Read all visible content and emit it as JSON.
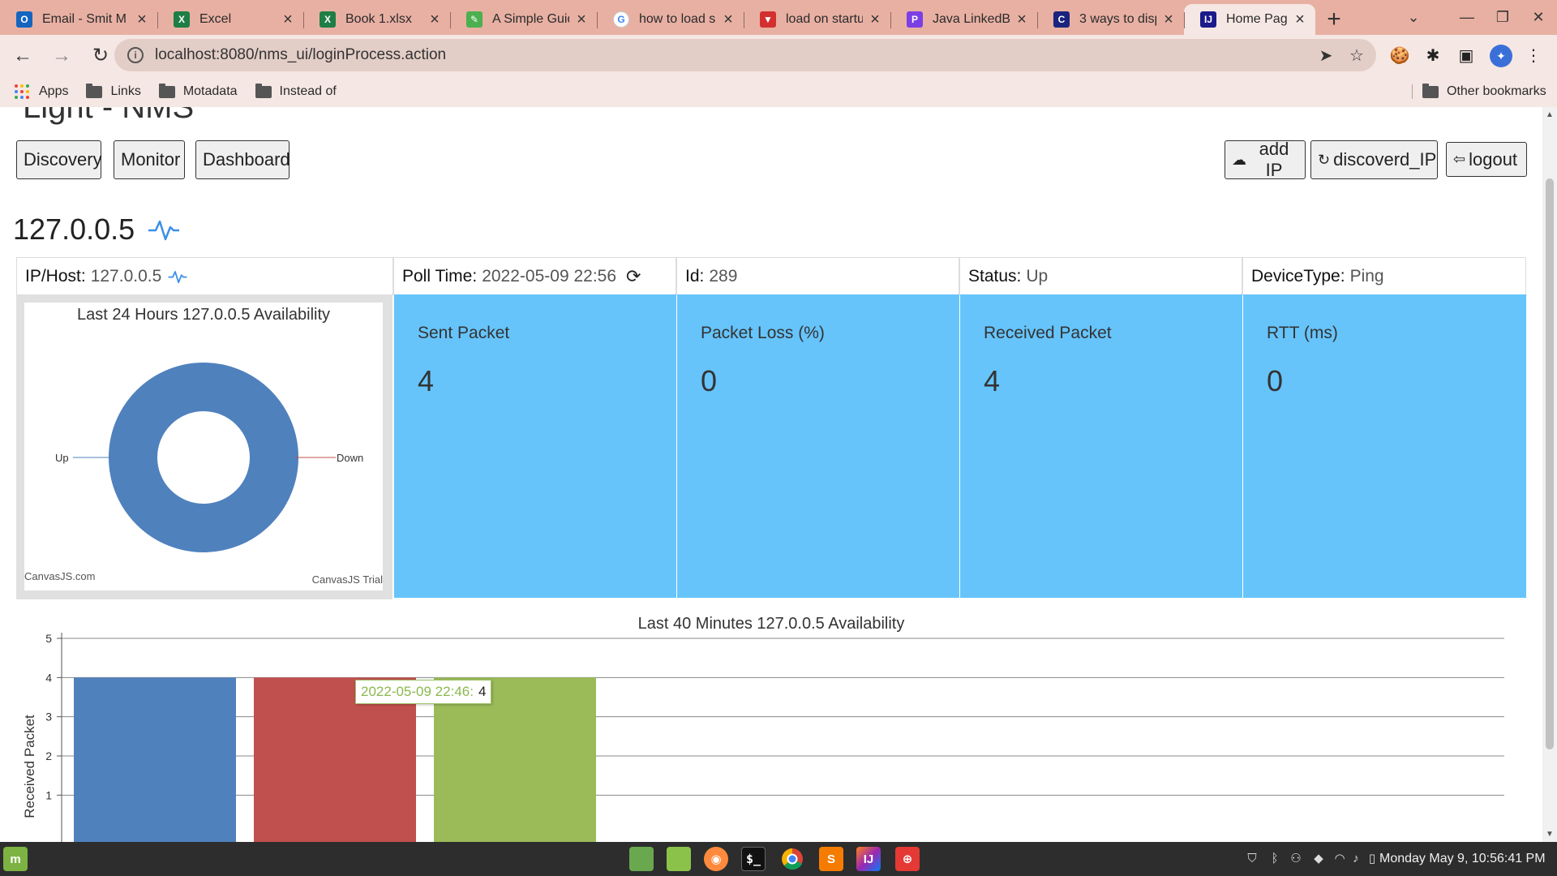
{
  "browser": {
    "tabs": [
      {
        "title": "Email - Smit M",
        "icon": "outlook-icon",
        "color": "#1565c0",
        "glyph": "O"
      },
      {
        "title": "Excel",
        "icon": "excel-icon",
        "color": "#1e7e45",
        "glyph": "X"
      },
      {
        "title": "Book 1.xlsx",
        "icon": "excel-icon",
        "color": "#1e7e45",
        "glyph": "X"
      },
      {
        "title": "A Simple Guid",
        "icon": "leaf-icon",
        "color": "#4caf50",
        "glyph": "✎"
      },
      {
        "title": "how to load s",
        "icon": "google-icon",
        "color": "#ffffff",
        "glyph": "G"
      },
      {
        "title": "load on startu",
        "icon": "vivaldi-icon",
        "color": "#d32f2f",
        "glyph": "▼"
      },
      {
        "title": "Java LinkedBl",
        "icon": "p-icon",
        "color": "#7b3fe4",
        "glyph": "P"
      },
      {
        "title": "3 ways to disp",
        "icon": "c-icon",
        "color": "#1a237e",
        "glyph": "C"
      },
      {
        "title": "Home Page",
        "icon": "intellij-icon",
        "color": "#1a1a8a",
        "glyph": "IJ"
      }
    ],
    "new_tab": "+",
    "url": "localhost:8080/nms_ui/loginProcess.action",
    "bookmarks": [
      "Apps",
      "Links",
      "Motadata",
      "Instead of"
    ],
    "other_bookmarks": "Other bookmarks"
  },
  "header": {
    "brand": "Light - NMS",
    "nav": [
      "Discovery",
      "Monitor",
      "Dashboard"
    ],
    "actions": {
      "add_ip": "add IP",
      "discovered": "discoverd_IP",
      "logout": "logout"
    }
  },
  "host": {
    "title": "127.0.0.5",
    "info": {
      "ip_label": "IP/Host:",
      "ip_value": "127.0.0.5",
      "poll_label": "Poll Time:",
      "poll_value": "2022-05-09 22:56",
      "id_label": "Id:",
      "id_value": "289",
      "status_label": "Status:",
      "status_value": "Up",
      "type_label": "DeviceType:",
      "type_value": "Ping"
    },
    "stats": [
      {
        "label": "Sent Packet",
        "value": "4"
      },
      {
        "label": "Packet Loss (%)",
        "value": "0"
      },
      {
        "label": "Received Packet",
        "value": "4"
      },
      {
        "label": "RTT (ms)",
        "value": "0"
      }
    ]
  },
  "colors": {
    "stat_bg": "#66c4fb",
    "donut": "#4f81bd",
    "bar1": "#4f81bd",
    "bar2": "#c0504d",
    "bar3": "#9bbb59"
  },
  "chart_data": [
    {
      "type": "pie",
      "title": "Last 24 Hours 127.0.0.5 Availability",
      "labels": [
        "Up",
        "Down"
      ],
      "values": [
        100,
        0
      ],
      "credit_left": "CanvasJS.com",
      "credit_right": "CanvasJS Trial"
    },
    {
      "type": "bar",
      "title": "Last 40 Minutes 127.0.0.5 Availability",
      "ylabel": "Received Packet",
      "categories": [
        "",
        "2022-05-09 22:46",
        ""
      ],
      "values": [
        4,
        4,
        4
      ],
      "ylim": [
        0,
        5
      ],
      "yticks": [
        1,
        2,
        3,
        4,
        5
      ],
      "tooltip": {
        "label": "2022-05-09 22:46:",
        "value": "4"
      }
    }
  ],
  "taskbar": {
    "clock": "Monday May  9, 10:56:41 PM"
  }
}
